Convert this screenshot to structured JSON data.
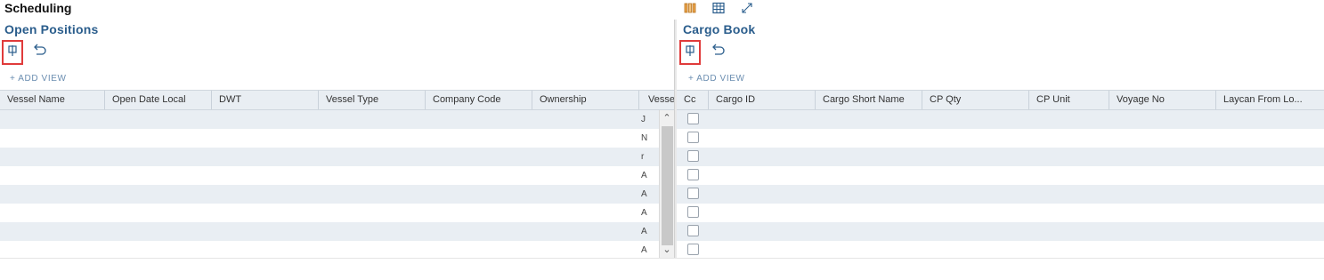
{
  "app": {
    "title": "Scheduling"
  },
  "toolbar_icons": [
    "columns-icon",
    "grid-icon",
    "expand-icon"
  ],
  "left_panel": {
    "title": "Open Positions",
    "add_view": "+ ADD VIEW",
    "columns": [
      "Vessel Name",
      "Open Date Local",
      "DWT",
      "Vessel Type",
      "Company Code",
      "Ownership",
      "Vesse"
    ],
    "row_count": 8,
    "partial_cells": [
      "J",
      "N",
      "r",
      "A",
      "A",
      "A",
      "A",
      "A"
    ]
  },
  "right_panel": {
    "title": "Cargo Book",
    "add_view": "+ ADD VIEW",
    "columns": [
      "Cc",
      "Cargo ID",
      "Cargo Short Name",
      "CP Qty",
      "CP Unit",
      "Voyage No",
      "Laycan From Lo..."
    ],
    "row_count": 8
  },
  "colors": {
    "title_blue": "#2a5d8c",
    "highlight_red": "#e03b3b",
    "stripe": "#e9eef3"
  }
}
